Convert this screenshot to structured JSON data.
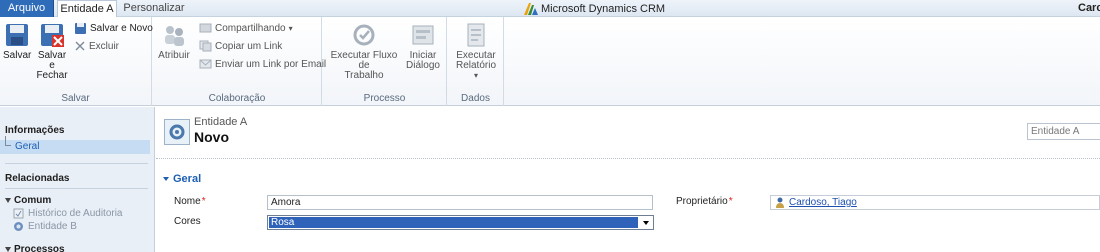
{
  "tabs": {
    "file": "Arquivo",
    "active": "Entidade A",
    "customize": "Personalizar"
  },
  "app_title": "Microsoft Dynamics CRM",
  "user_name_partial": "Carc",
  "ribbon": {
    "salvar": {
      "save": "Salvar",
      "save_close_1": "Salvar e",
      "save_close_2": "Fechar",
      "save_new": "Salvar e Novo",
      "delete": "Excluir",
      "label": "Salvar"
    },
    "colaboracao": {
      "assign": "Atribuir",
      "share": "Compartilhando",
      "copy_link": "Copiar um Link",
      "email_link": "Enviar um Link por Email",
      "label": "Colaboração"
    },
    "processo": {
      "workflow_1": "Executar Fluxo de",
      "workflow_2": "Trabalho",
      "dialog_1": "Iniciar",
      "dialog_2": "Diálogo",
      "label": "Processo"
    },
    "dados": {
      "report_1": "Executar",
      "report_2": "Relatório",
      "label": "Dados"
    }
  },
  "nav": {
    "info_header": "Informações",
    "general": "Geral",
    "related_header": "Relacionadas",
    "common_header": "Comum",
    "audit_history": "Histórico de Auditoria",
    "entity_b": "Entidade B",
    "processes_header": "Processos"
  },
  "form": {
    "entity_name": "Entidade A",
    "record_title": "Novo",
    "form_selector": "Entidade A",
    "section_title": "Geral",
    "name_label": "Nome",
    "name_value": "Amora",
    "colors_label": "Cores",
    "colors_value": "Rosa",
    "owner_label": "Proprietário",
    "owner_value": "Cardoso, Tiago",
    "required_mark": "*"
  },
  "colors": {
    "file_tab": "#2e6bb8",
    "accent": "#1d5fb5",
    "selection": "#2e63b9",
    "required": "#e02020"
  }
}
